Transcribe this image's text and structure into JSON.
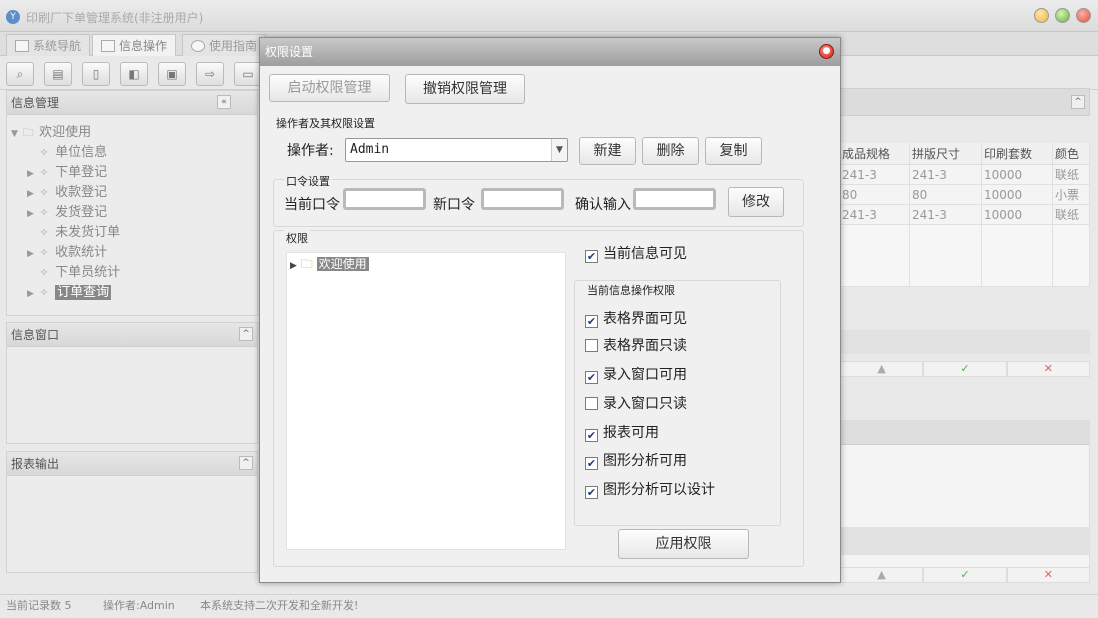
{
  "app": {
    "title": "印刷厂下单管理系统(非注册用户)"
  },
  "tabs": [
    {
      "label": "系统导航"
    },
    {
      "label": "信息操作"
    },
    {
      "label": "使用指南"
    }
  ],
  "left": {
    "info_title": "信息管理",
    "tree": [
      {
        "label": "欢迎使用"
      },
      {
        "label": "单位信息"
      },
      {
        "label": "下单登记"
      },
      {
        "label": "收款登记"
      },
      {
        "label": "发货登记"
      },
      {
        "label": "未发货订单"
      },
      {
        "label": "收款统计"
      },
      {
        "label": "下单员统计"
      },
      {
        "label": "订单查询"
      }
    ],
    "window_title": "信息窗口",
    "report_title": "报表输出"
  },
  "grid": {
    "headers": [
      "成品规格",
      "拼版尺寸",
      "印刷套数",
      "颜色"
    ],
    "rows": [
      [
        "241-3",
        "241-3",
        "10000",
        "联纸"
      ],
      [
        "80",
        "80",
        "10000",
        "小票"
      ],
      [
        "241-3",
        "241-3",
        "10000",
        "联纸"
      ]
    ]
  },
  "status": {
    "records": "当前记录数 5",
    "operator": "操作者:Admin",
    "note": "本系统支持二次开发和全新开发!"
  },
  "dialog": {
    "title": "权限设置",
    "enable_btn": "启动权限管理",
    "revoke_btn": "撤销权限管理",
    "operator_group": "操作者及其权限设置",
    "operator_label": "操作者:",
    "operator_value": "Admin",
    "new_btn": "新建",
    "delete_btn": "删除",
    "copy_btn": "复制",
    "pwd_group": "口令设置",
    "current_pwd": "当前口令",
    "new_pwd": "新口令",
    "confirm_pwd": "确认输入",
    "modify_btn": "修改",
    "perm_group": "权限",
    "perm_tree_root": "欢迎使用",
    "current_visible": "当前信息可见",
    "op_group": "当前信息操作权限",
    "checks": [
      {
        "label": "表格界面可见",
        "checked": true
      },
      {
        "label": "表格界面只读",
        "checked": false
      },
      {
        "label": "录入窗口可用",
        "checked": true
      },
      {
        "label": "录入窗口只读",
        "checked": false
      },
      {
        "label": "报表可用",
        "checked": true
      },
      {
        "label": "图形分析可用",
        "checked": true
      },
      {
        "label": "图形分析可以设计",
        "checked": true
      }
    ],
    "apply_btn": "应用权限"
  }
}
